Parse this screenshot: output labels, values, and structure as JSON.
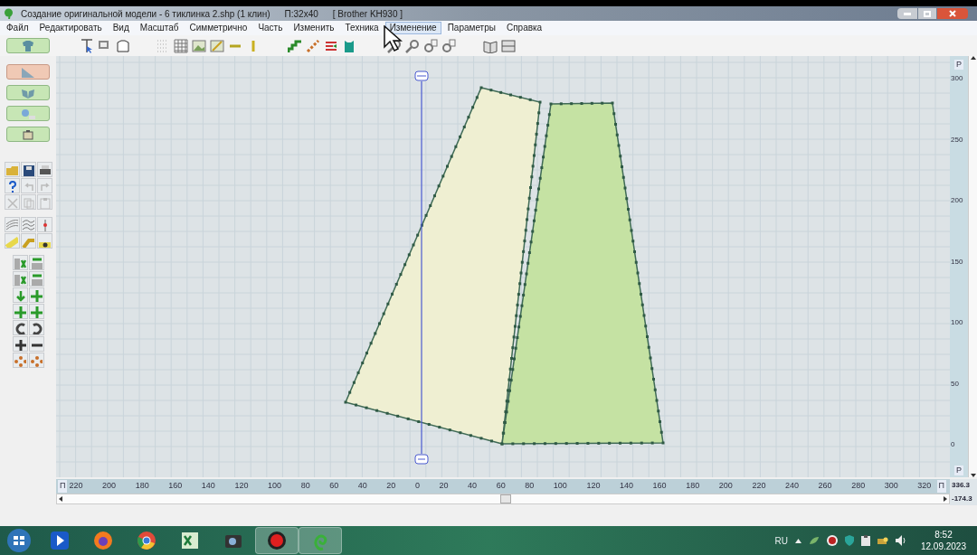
{
  "window": {
    "title": "Создание оригинальной модели - 6 тиклинка 2.shp (1 клин)",
    "size": "П:32x40",
    "machine": "[ Brother KH930 ]"
  },
  "menu": [
    {
      "label": "Файл",
      "selected": false
    },
    {
      "label": "Редактировать",
      "selected": false
    },
    {
      "label": "Вид",
      "selected": false
    },
    {
      "label": "Масштаб",
      "selected": false
    },
    {
      "label": "Симметрично",
      "selected": false
    },
    {
      "label": "Часть",
      "selected": false
    },
    {
      "label": "Изменить",
      "selected": false
    },
    {
      "label": "Техника",
      "selected": false
    },
    {
      "label": "Изменение",
      "selected": true
    },
    {
      "label": "Параметры",
      "selected": false
    },
    {
      "label": "Справка",
      "selected": false
    }
  ],
  "mode_buttons": [
    {
      "selected": false
    },
    {
      "selected": true
    },
    {
      "selected": false
    },
    {
      "selected": false
    },
    {
      "selected": false
    }
  ],
  "right_ruler": {
    "top_mark": "P",
    "labels": [
      "300",
      "250",
      "200",
      "150",
      "100",
      "50",
      "0"
    ],
    "bottom_mark": "P"
  },
  "bottom_ruler": {
    "left_mark": "П",
    "labels": [
      "220",
      "200",
      "180",
      "160",
      "140",
      "120",
      "100",
      "80",
      "60",
      "40",
      "20",
      "0",
      "20",
      "40",
      "60",
      "80",
      "100",
      "120",
      "140",
      "160",
      "180",
      "200",
      "220",
      "240",
      "260",
      "280",
      "300",
      "320"
    ],
    "right_mark": "П"
  },
  "readouts": [
    "336.3",
    "-174.3"
  ],
  "taskbar": {
    "language": "RU",
    "time": "8:52",
    "date": "12.09.2023"
  }
}
